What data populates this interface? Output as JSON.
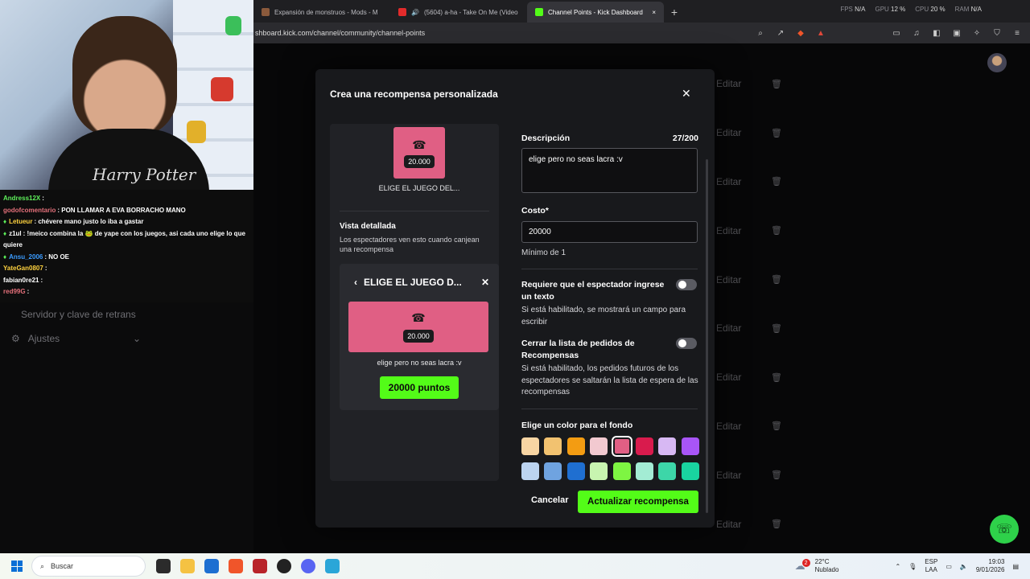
{
  "browser": {
    "tabs": [
      {
        "label": "Expansión de monstruos - Mods - M",
        "color": "#8b5a3c",
        "active": false
      },
      {
        "label": "(5604) a-ha - Take On Me (Video",
        "color": "#e22b2b",
        "active": false
      },
      {
        "label": "Channel Points - Kick Dashboard",
        "color": "#53fc18",
        "active": true
      }
    ],
    "perf": {
      "fps_label": "FPS",
      "fps_value": "N/A",
      "gpu_label": "GPU",
      "gpu_value": "12 %",
      "cpu_label": "CPU",
      "cpu_value": "20 %",
      "ram_label": "RAM",
      "ram_value": "N/A"
    },
    "url": "shboard.kick.com/channel/community/channel-points"
  },
  "chat": [
    {
      "user": "Andress12X",
      "user_color": "#5ef05a",
      "badge": "",
      "message": ":"
    },
    {
      "user": "godofcomentario",
      "user_color": "#e4707a",
      "badge": "",
      "message": ": PON LLAMAR A EVA BORRACHO MANO"
    },
    {
      "user": "Letueur",
      "user_color": "#ffd23f",
      "badge": "♦",
      "message": ": chévere mano justo lo iba a gastar"
    },
    {
      "user": "z1ul",
      "user_color": "#ffffff",
      "badge": "♦",
      "message": ": !meico combina la 🐸 de yape con los juegos, asi cada uno elige lo que"
    },
    {
      "user": "",
      "user_color": "#ffffff",
      "badge": "",
      "message": "quiere"
    },
    {
      "user": "Ansu_2006",
      "user_color": "#3b9cff",
      "badge": "♦",
      "message": ": NO OE"
    },
    {
      "user": "YateGan0807",
      "user_color": "#ffd23f",
      "badge": "",
      "message": ":"
    },
    {
      "user": "fabian0re21",
      "user_color": "#ffffff",
      "badge": "",
      "message": ":"
    },
    {
      "user": "red99G",
      "user_color": "#e4707a",
      "badge": "",
      "message": ":"
    }
  ],
  "sidebar_faded": {
    "item": "Servidor y clave de retrans",
    "settings": "Ajustes"
  },
  "dashboard": {
    "edit_label": "Editar",
    "row_count": 10
  },
  "modal": {
    "title": "Crea una recompensa personalizada",
    "preview": {
      "cost": "20.000",
      "tile_label": "ELIGE EL JUEGO DEL...",
      "detail_heading": "Vista detallada",
      "detail_sub": "Los espectadores ven esto cuando canjean una recompensa",
      "card_title": "ELIGE EL JUEGO D...",
      "card_cost": "20.000",
      "card_description": "elige pero no seas lacra :v",
      "points_button": "20000 puntos"
    },
    "form": {
      "description_label": "Descripción",
      "description_counter": "27/200",
      "description_value": "elige pero no seas lacra :v",
      "cost_label": "Costo*",
      "cost_value": "20000",
      "cost_hint": "Mínimo de 1",
      "require_text_label": "Requiere que el espectador ingrese un texto",
      "require_text_hint": "Si está habilitado, se mostrará un campo para escribir",
      "close_queue_label": "Cerrar la lista de pedidos de Recompensas",
      "close_queue_hint": "Si está habilitado, los pedidos futuros de los espectadores se saltarán la lista de espera de las recompensas",
      "color_label": "Elige un color para el fondo",
      "colors": [
        "#f8d5a3",
        "#f2c270",
        "#f39c12",
        "#f2c9d0",
        "#e05f84",
        "#d91b4d",
        "#d7b8f3",
        "#a855f7",
        "#bcd4f0",
        "#6fa3e0",
        "#1f6fd1",
        "#c8f5b0",
        "#7ef542",
        "#a3ecd4",
        "#3dd6a8",
        "#19d4a0"
      ],
      "selected_color": "#e05f84"
    },
    "cancel_label": "Cancelar",
    "update_label": "Actualizar recompensa"
  },
  "taskbar": {
    "search_placeholder": "Buscar",
    "weather_temp": "22°C",
    "weather_desc": "Nublado",
    "weather_badge": "2",
    "lang_top": "ESP",
    "lang_bottom": "LAA",
    "time": "19:03",
    "date": "9/01/2026"
  },
  "webcam": {
    "shirt_text": "Harry Potter"
  }
}
